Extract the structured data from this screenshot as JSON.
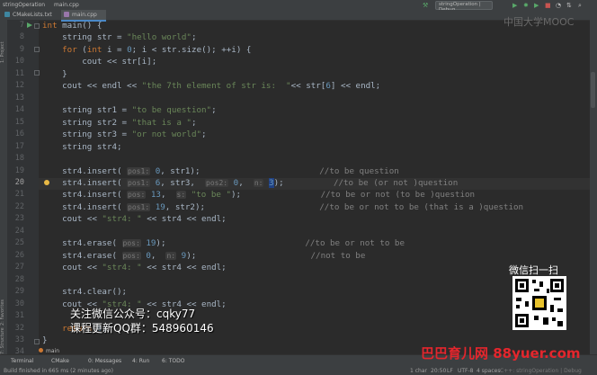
{
  "window": {
    "project": "stringOperation",
    "file": "main.cpp",
    "run_config": "stringOperation | Debug"
  },
  "tabs": [
    {
      "label": "CMakeLists.txt",
      "icon": "cmake-file-icon",
      "color": "#3e86a0"
    },
    {
      "label": "main.cpp",
      "icon": "cpp-file-icon",
      "color": "#9876aa"
    }
  ],
  "side_panels": {
    "project": "1: Project",
    "favorites": "2: Favorites",
    "structure": "7: Structure"
  },
  "code_lines": [
    {
      "n": "7",
      "html": "<span class=\"kw\">int</span> main() {"
    },
    {
      "n": "8",
      "html": "    string str = <span class=\"st\">\"hello world\"</span>;"
    },
    {
      "n": "9",
      "html": "    <span class=\"kw\">for</span> (<span class=\"kw\">int</span> i = <span class=\"num\">0</span>; i &lt; str.size(); ++i) {"
    },
    {
      "n": "10",
      "html": "        cout &lt;&lt; str[i];"
    },
    {
      "n": "11",
      "html": "    }"
    },
    {
      "n": "12",
      "html": "    cout &lt;&lt; endl &lt;&lt; <span class=\"st\">\"the 7th element of str is:  \"</span>&lt;&lt; str[<span class=\"num\">6</span>] &lt;&lt; endl;"
    },
    {
      "n": "13",
      "html": ""
    },
    {
      "n": "14",
      "html": "    string str1 = <span class=\"st\">\"to be question\"</span>;"
    },
    {
      "n": "15",
      "html": "    string str2 = <span class=\"st\">\"that is a \"</span>;"
    },
    {
      "n": "16",
      "html": "    string str3 = <span class=\"st\">\"or not world\"</span>;"
    },
    {
      "n": "17",
      "html": "    string str4;"
    },
    {
      "n": "18",
      "html": ""
    },
    {
      "n": "19",
      "html": "    str4.insert( <span class=\"hint\">pos1:</span> <span class=\"num\">0</span>, str1);                        <span class=\"cm\">//to be question</span>"
    },
    {
      "n": "20",
      "html": "    str4.insert( <span class=\"hint\">pos1:</span> <span class=\"num\">6</span>, str3,  <span class=\"hint\">pos2:</span> <span class=\"num\">0</span>,  <span class=\"hint\">n:</span> <span class=\"num sel\">3</span>);          <span class=\"cm\">//to be (or not )question</span>"
    },
    {
      "n": "21",
      "html": "    str4.insert( <span class=\"hint\">pos:</span> <span class=\"num\">13</span>,  <span class=\"hint\">s:</span> <span class=\"st\">\"to be \"</span>);                <span class=\"cm\">//to be or not (to be )question</span>"
    },
    {
      "n": "22",
      "html": "    str4.insert( <span class=\"hint\">pos1:</span> <span class=\"num\">19</span>, str2);                       <span class=\"cm\">//to be or not to be (that is a )question</span>"
    },
    {
      "n": "23",
      "html": "    cout &lt;&lt; <span class=\"st\">\"str4: \"</span> &lt;&lt; str4 &lt;&lt; endl;"
    },
    {
      "n": "24",
      "html": ""
    },
    {
      "n": "25",
      "html": "    str4.erase( <span class=\"hint\">pos:</span> <span class=\"num\">19</span>);                            <span class=\"cm\">//to be or not to be</span>"
    },
    {
      "n": "26",
      "html": "    str4.erase( <span class=\"hint\">pos:</span> <span class=\"num\">0</span>,  <span class=\"hint\">n:</span> <span class=\"num\">9</span>);                       <span class=\"cm\">//not to be</span>"
    },
    {
      "n": "27",
      "html": "    cout &lt;&lt; <span class=\"st\">\"str4: \"</span> &lt;&lt; str4 &lt;&lt; endl;"
    },
    {
      "n": "28",
      "html": ""
    },
    {
      "n": "29",
      "html": "    str4.clear();"
    },
    {
      "n": "30",
      "html": "    cout &lt;&lt; <span class=\"st\">\"str4: \"</span> &lt;&lt; str4 &lt;&lt; endl;"
    },
    {
      "n": "31",
      "html": ""
    },
    {
      "n": "32",
      "html": "    <span class=\"kw\">return</span> <span class=\"num\">0</span>;"
    },
    {
      "n": "33",
      "html": "}"
    },
    {
      "n": "34",
      "html": ""
    }
  ],
  "breadcrumb": "main",
  "toolwindows": {
    "terminal": "Terminal",
    "cmake": "CMake",
    "messages": "0: Messages",
    "run": "4: Run",
    "todo": "6: TODO"
  },
  "status": {
    "build": "Build finished in 665 ms (2 minutes ago)",
    "chars": "1 char",
    "position": "20:50",
    "line_sep": "LF",
    "encoding": "UTF-8",
    "indent": "4 spaces",
    "context": "C++: stringOperation | Debug"
  },
  "overlays": {
    "top_watermark": "中国大学MOOC",
    "qr_label": "微信扫一扫",
    "ad_line1": "关注微信公众号：cqky77",
    "ad_line2": "课程更新QQ群：548960146",
    "brand": "巴巴育儿网 88yuer.com"
  },
  "colors": {
    "bg": "#2b2b2b",
    "keyword": "#cc7832",
    "string": "#6a8759",
    "number": "#6897bb",
    "comment": "#808080",
    "brand": "#e4262d"
  }
}
